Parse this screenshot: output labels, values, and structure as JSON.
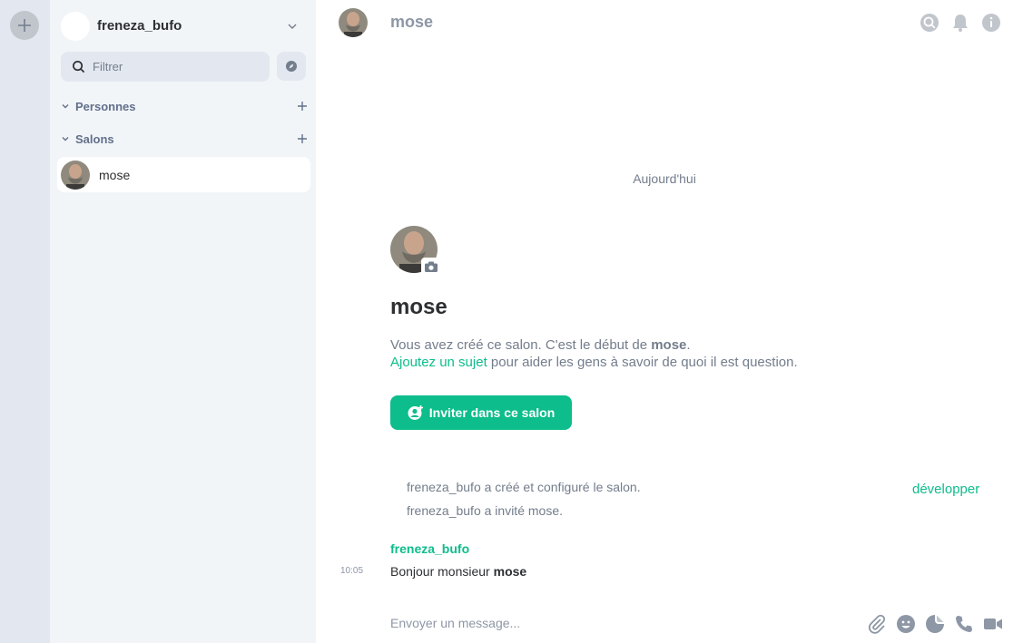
{
  "account": {
    "username": "freneza_bufo"
  },
  "search": {
    "placeholder": "Filtrer"
  },
  "sections": {
    "people": "Personnes",
    "rooms": "Salons"
  },
  "rooms": [
    {
      "name": "mose"
    }
  ],
  "header": {
    "room_name": "mose"
  },
  "timeline": {
    "date_separator": "Aujourd'hui",
    "intro": {
      "title": "mose",
      "line1_prefix": "Vous avez créé ce salon. C'est le début de ",
      "line1_room": "mose",
      "line1_suffix": ".",
      "topic_link": "Ajoutez un sujet",
      "line2_suffix": " pour aider les gens à savoir de quoi il est question.",
      "invite_button": "Inviter dans ce salon"
    },
    "events": [
      "freneza_bufo a créé et configuré le salon.",
      "freneza_bufo a invité mose."
    ],
    "expand_label": "développer",
    "message": {
      "sender": "freneza_bufo",
      "time": "10:05",
      "text_prefix": "Bonjour monsieur ",
      "text_bold": "mose"
    }
  },
  "composer": {
    "placeholder": "Envoyer un message..."
  },
  "colors": {
    "accent": "#0dbd8b",
    "muted": "#737d8c",
    "sidebar_bg": "#f2f5f8",
    "space_bg": "#e3e8f0"
  },
  "icons": [
    "plus-icon",
    "chevron-down-icon",
    "search-icon",
    "compass-icon",
    "bell-icon",
    "info-icon",
    "camera-icon",
    "invite-user-icon",
    "paperclip-icon",
    "emoji-icon",
    "sticker-icon",
    "phone-icon",
    "video-icon"
  ]
}
